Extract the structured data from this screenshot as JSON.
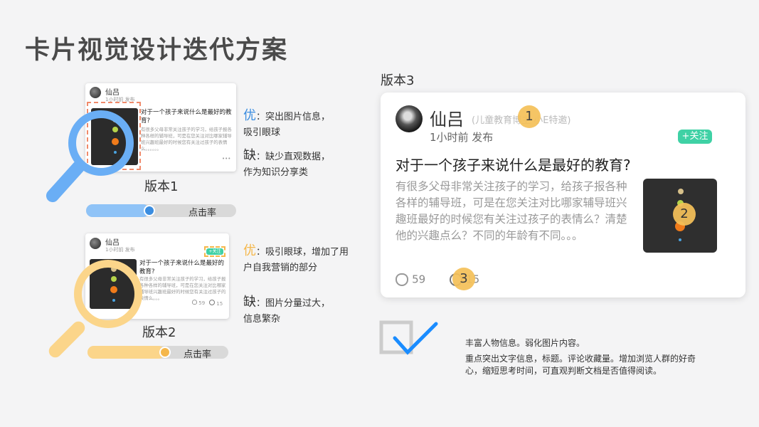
{
  "title": "卡片视觉设计迭代方案",
  "card_post": {
    "author": "仙吕",
    "time_posted": "1小时前  发布",
    "question": "对于一个孩子来说什么是最好的教育?",
    "body": "有很多父母非常关注孩子的学习，给孩子报各种各样的辅导班，可是在您关注对比哪家辅导班兴趣班最好的时候您有关注过孩子的表情么？清楚他的兴趣点么？不同的年龄有不同。。。",
    "follow_label": "+关注",
    "likes": "59",
    "comments": "15"
  },
  "version1": {
    "card_body": "有很多父母非常关注孩子的学习，给孩子报各种各样的辅导班，可是在您关注对比哪家辅导班兴趣班最好的时候您有关注过孩子的表情么。。。。。。",
    "more": "•••",
    "label": "版本1",
    "pro_label": "优",
    "pro_text": "：突出图片信息，吸引眼球",
    "con_label": "缺",
    "con_text": "：缺少直观数据，作为知识分享类",
    "bar_label": "点击率",
    "ctr_fraction": 0.42,
    "lens_color": "#6aaef5"
  },
  "version2": {
    "card_body": "有很多父母非常关注孩子的学习，给孩子报各种各样的辅导班，可是在您关注对比哪家辅导班兴趣班最好的时候您有关注过孩子的表情么。。。",
    "label": "版本2",
    "pro_label": "优",
    "pro_text": "：吸引眼球，增加了用户自我营销的部分",
    "con_label": "缺",
    "con_text": "：图片分量过大，信息繁杂",
    "bar_label": "点击率",
    "ctr_fraction": 0.55,
    "lens_color": "#fbd58a"
  },
  "version3": {
    "label": "版本3",
    "name_meta": "(儿童教育博主  小E特邀)",
    "badges": [
      "1",
      "2",
      "3"
    ]
  },
  "summary": {
    "line1": "丰富人物信息。弱化图片内容。",
    "line2": "重点突出文字信息，标题。评论收藏量。增加浏览人群的好奇心，缩短思考时间，可直观判断文档是否值得阅读。"
  },
  "colors": {
    "pro_blue": "#3b8de0",
    "pro_yellow": "#f5b74a",
    "follow_green": "#3fd1a5",
    "badge_yellow": "#f5c15a",
    "check_blue": "#1a8cff"
  }
}
